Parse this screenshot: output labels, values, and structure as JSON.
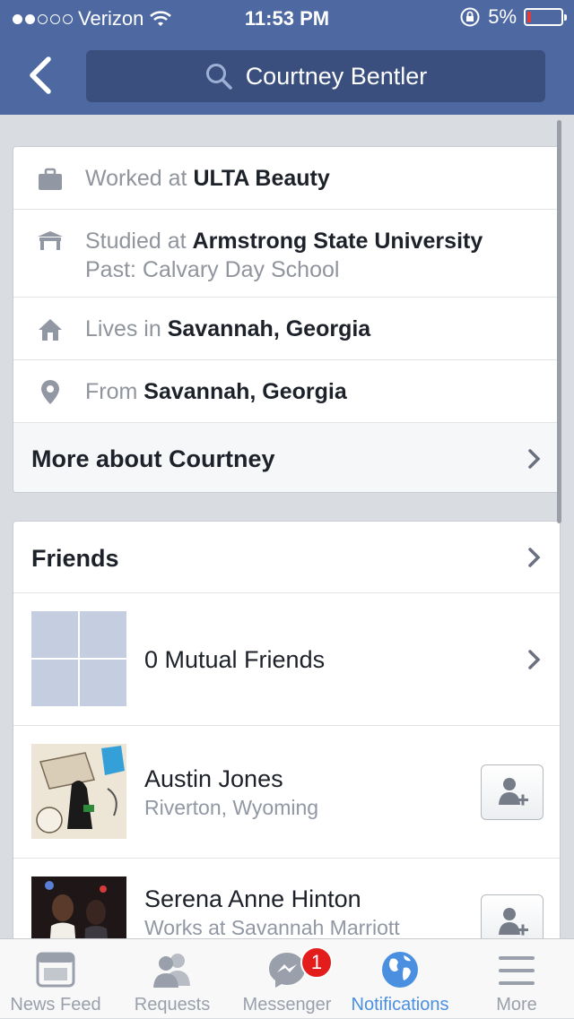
{
  "status_bar": {
    "carrier": "Verizon",
    "time": "11:53 PM",
    "battery": "5%"
  },
  "header": {
    "search_text": "Courtney Bentler"
  },
  "about": {
    "worked_prefix": "Worked at",
    "worked_value": "ULTA Beauty",
    "studied_prefix": "Studied at",
    "studied_value": "Armstrong State University",
    "studied_past": "Past: Calvary Day School",
    "lives_prefix": "Lives in",
    "lives_value": "Savannah, Georgia",
    "from_prefix": "From",
    "from_value": "Savannah, Georgia",
    "more_label": "More about Courtney"
  },
  "friends": {
    "title": "Friends",
    "mutual_label": "0 Mutual Friends",
    "people": [
      {
        "name": "Austin Jones",
        "detail": "Riverton, Wyoming"
      },
      {
        "name": "Serena Anne Hinton",
        "detail": "Works at Savannah Marriott"
      }
    ]
  },
  "tabbar": {
    "tabs": [
      {
        "label": "News Feed",
        "icon": "news-feed-icon"
      },
      {
        "label": "Requests",
        "icon": "friend-requests-icon"
      },
      {
        "label": "Messenger",
        "icon": "messenger-icon",
        "badge": "1"
      },
      {
        "label": "Notifications",
        "icon": "globe-icon",
        "active": true
      },
      {
        "label": "More",
        "icon": "menu-icon"
      }
    ]
  },
  "colors": {
    "header_bg": "#4e69a2",
    "active_tab": "#4a8fe0",
    "badge": "#e31c1c"
  }
}
